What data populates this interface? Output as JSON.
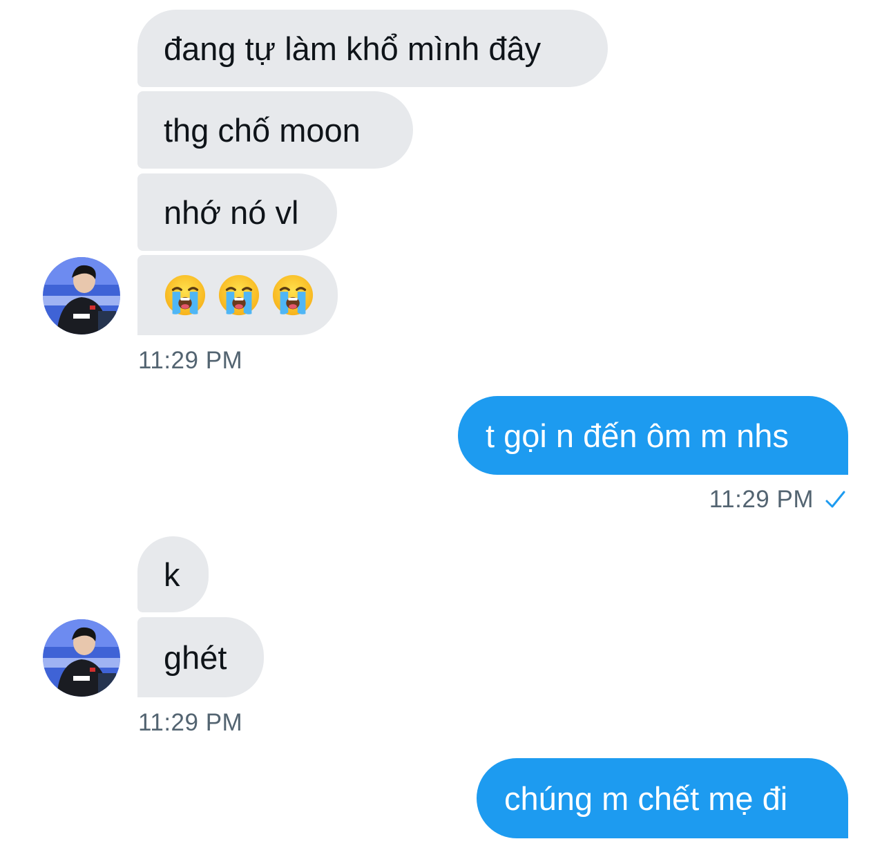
{
  "thread": {
    "incoming_group_1": {
      "messages": [
        "đang tự làm khổ mình đây",
        "thg chố moon",
        "nhớ nó vl"
      ],
      "emoji_message": [
        "loudly-crying-face-icon",
        "loudly-crying-face-icon",
        "loudly-crying-face-icon"
      ],
      "timestamp": "11:29 PM"
    },
    "outgoing_1": {
      "text": "t gọi n đến ôm m nhs",
      "timestamp": "11:29 PM",
      "status_icon": "checkmark-icon"
    },
    "incoming_group_2": {
      "messages": [
        "k",
        "ghét"
      ],
      "timestamp": "11:29 PM"
    },
    "outgoing_2": {
      "text": "chúng m chết mẹ đi"
    }
  },
  "colors": {
    "incoming_bubble": "#e7e9ec",
    "outgoing_bubble": "#1d9bf0",
    "timestamp_text": "#536471",
    "checkmark": "#1d9bf0"
  }
}
